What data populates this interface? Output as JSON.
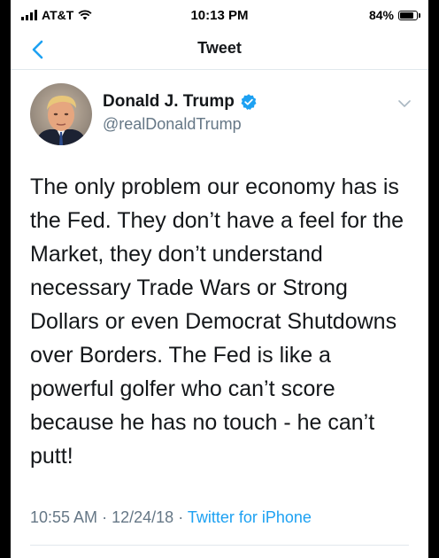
{
  "status_bar": {
    "carrier": "AT&T",
    "time": "10:13 PM",
    "battery_percent": "84%",
    "battery_level": 0.84
  },
  "nav": {
    "title": "Tweet"
  },
  "tweet": {
    "author_name": "Donald J. Trump",
    "author_handle": "@realDonaldTrump",
    "text": "The only problem our economy has is the Fed. They don’t have a feel for the Market, they don’t understand necessary Trade Wars or Strong Dollars or even Democrat Shutdowns over Borders. The Fed is like a powerful golfer who can’t score because he has no touch - he can’t putt!",
    "time": "10:55 AM",
    "date": "12/24/18",
    "separator": "·",
    "source": "Twitter for iPhone"
  },
  "colors": {
    "accent": "#1da1f2",
    "text": "#14171a",
    "secondary": "#657786"
  },
  "icons": [
    "signal-icon",
    "wifi-icon",
    "battery-icon",
    "back-chevron-icon",
    "verified-badge-icon",
    "caret-down-icon"
  ]
}
